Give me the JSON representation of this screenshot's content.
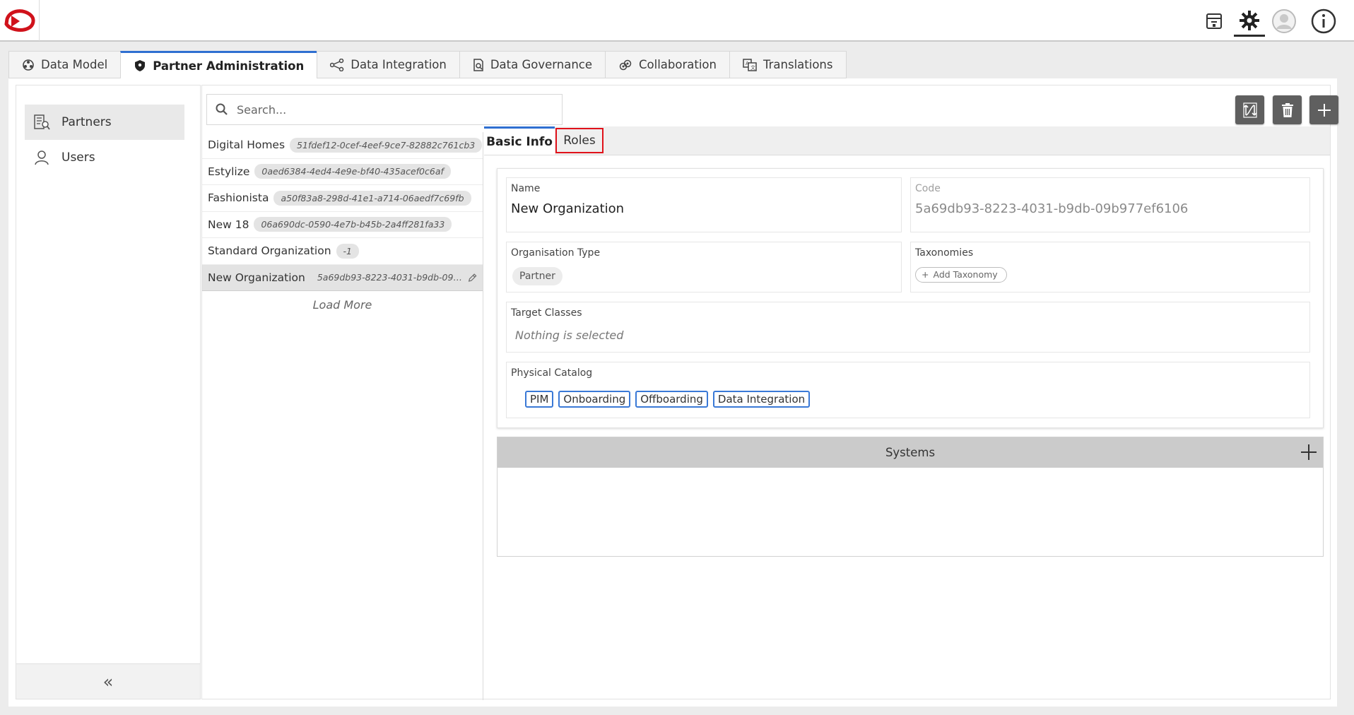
{
  "header": {
    "icons": [
      "logo-icon",
      "archive-icon",
      "gear-icon",
      "user-avatar-icon",
      "info-icon"
    ]
  },
  "tabs": [
    {
      "label": "Data Model",
      "icon": "data-model-icon"
    },
    {
      "label": "Partner Administration",
      "icon": "shield-icon",
      "active": true
    },
    {
      "label": "Data Integration",
      "icon": "integration-icon"
    },
    {
      "label": "Data Governance",
      "icon": "governance-icon"
    },
    {
      "label": "Collaboration",
      "icon": "collaboration-icon"
    },
    {
      "label": "Translations",
      "icon": "translate-icon"
    }
  ],
  "sidebar": {
    "items": [
      {
        "label": "Partners",
        "icon": "partners-icon",
        "active": true
      },
      {
        "label": "Users",
        "icon": "user-icon"
      }
    ],
    "collapse_label": "«"
  },
  "search": {
    "placeholder": "Search..."
  },
  "actions": [
    "sync-icon",
    "trash-icon",
    "plus-icon"
  ],
  "partners": [
    {
      "name": "Digital Homes",
      "code": "51fdef12-0cef-4eef-9ce7-82882c761cb3"
    },
    {
      "name": "Estylize",
      "code": "0aed6384-4ed4-4e9e-bf40-435acef0c6af"
    },
    {
      "name": "Fashionista",
      "code": "a50f83a8-298d-41e1-a714-06aedf7c69fb"
    },
    {
      "name": "New 18",
      "code": "06a690dc-0590-4e7b-b45b-2a4ff281fa33"
    },
    {
      "name": "Standard Organization",
      "code": "-1"
    },
    {
      "name": "New Organization",
      "code": "5a69db93-8223-4031-b9db-09b977ef...",
      "selected": true
    }
  ],
  "load_more": "Load More",
  "detail": {
    "tabs": {
      "basic": "Basic Info",
      "roles": "Roles"
    },
    "name_label": "Name",
    "name_value": "New Organization",
    "code_label": "Code",
    "code_value": "5a69db93-8223-4031-b9db-09b977ef6106",
    "org_type_label": "Organisation Type",
    "org_type_value": "Partner",
    "taxonomies_label": "Taxonomies",
    "add_taxonomy": "Add Taxonomy",
    "target_classes_label": "Target Classes",
    "target_classes_value": "Nothing is selected",
    "physical_catalog_label": "Physical Catalog",
    "catalogs": [
      "PIM",
      "Onboarding",
      "Offboarding",
      "Data Integration"
    ],
    "systems_label": "Systems"
  },
  "colors": {
    "accent": "#2f6fd1",
    "highlight": "#e0121a",
    "logo": "#d0121b"
  }
}
